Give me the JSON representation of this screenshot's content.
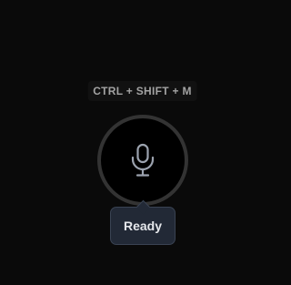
{
  "shortcut": {
    "label": "CTRL + SHIFT + M"
  },
  "mic_button": {
    "icon": "microphone-icon"
  },
  "status": {
    "label": "Ready"
  },
  "colors": {
    "background": "#0a0a0a",
    "ring": "#333333",
    "icon": "#9ca3af",
    "pill_background": "#222936",
    "pill_border": "#3a4353",
    "pill_text": "#e5e7eb",
    "shortcut_text": "#a3a3a3"
  }
}
